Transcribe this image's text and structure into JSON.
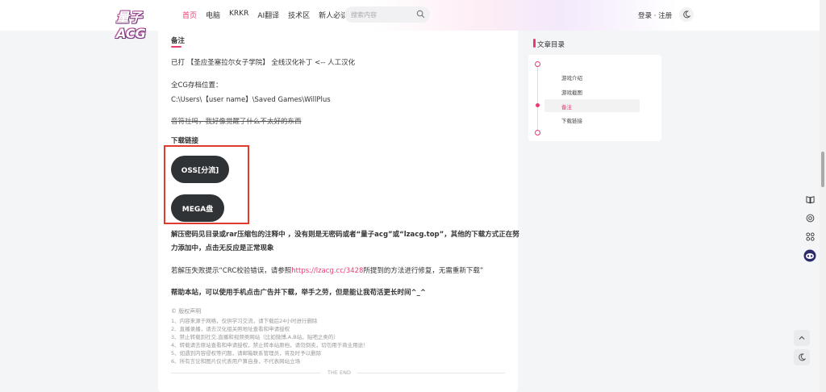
{
  "header": {
    "logo_text": "量子ACG",
    "nav": [
      "首页",
      "电脑",
      "KRKR",
      "AI翻译",
      "技术区",
      "新人必读"
    ],
    "search_placeholder": "搜索内容",
    "auth": "登录 · 注册"
  },
  "article": {
    "note_heading": "备注",
    "patched": "已打 【圣应圣塞拉尔女子学院】 全线汉化补丁 <-- 人工汉化",
    "cg_label": "全CG存档位置：",
    "cg_path": "C:\\Users\\【user name】\\Saved Games\\WillPlus",
    "strike_text": "音符社吗，我好像觉醒了什么不太好的东西",
    "download_heading": "下载链接",
    "buttons": [
      "OSS[分流]",
      "MEGA盘"
    ],
    "unzip_line1": "解压密码见目录或rar压缩包的注释中 ，没有则是无密码或者“量子acg”或“lzacg.top”，其他的下载方式正在努",
    "unzip_line2": "力添加中，点击无反应是正常现象",
    "crc_before": "若解压失败提示“CRC校验错误，请参照",
    "crc_link": "https://lzacg.cc/3428",
    "crc_after": "所提到的方法进行修复，无需重新下载”",
    "help": "帮助本站，可以使用手机点击广告并下载，举手之劳，但是能让我苟活更长时间^_^",
    "copyright_title": "© 版权声明",
    "copyright": [
      "1、内容来源于网络，仅供学习交流，请下载后24小时进行删除",
      "2、直播录播，请去汉化组关照地址查看和申请授权",
      "3、禁止转载到社交,直播和视频类网站（比如微博,A,B站，贴吧之类的）",
      "4、转载请去原站查看和申请授权，禁止转本站原档，请勿倒卖，切勿用于商业用途！",
      "5、如遇到内容侵权等问题，请邮箱联系管理员，将及时予以删除",
      "6、所有言论和图片仅代表用户算自身，不代表网站立场"
    ],
    "the_end": "THE END"
  },
  "toc": {
    "title": "文章目录",
    "items": [
      "游戏介绍",
      "游戏截图",
      "备注",
      "下载链接"
    ],
    "active_index": 2
  },
  "colors": {
    "accent": "#e83c6f",
    "button_dark": "#2f3336",
    "highlight_box": "#e23a2e"
  },
  "icons": {
    "search": "search-icon",
    "theme": "moon-icon",
    "book": "book-icon",
    "globe": "globe-icon",
    "grid": "grid-icon",
    "bot": "bot-icon",
    "up": "chevron-up-icon"
  }
}
